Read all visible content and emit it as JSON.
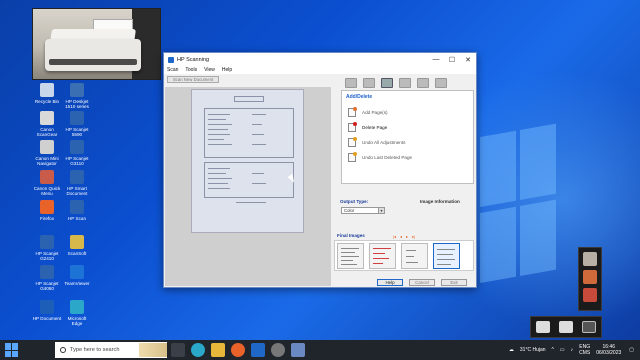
{
  "desktop": {
    "icons": [
      {
        "label": "Recycle Bin",
        "color": "#c9d7ea"
      },
      {
        "label": "HP Deskjet 1510 series",
        "color": "#3a6fb3"
      },
      {
        "label": "Canon ScanGear",
        "color": "#d9d9d9"
      },
      {
        "label": "HP Scanjet 5590",
        "color": "#2b63b0"
      },
      {
        "label": "Canon Mini Navigator",
        "color": "#d0d0d0"
      },
      {
        "label": "HP Scanjet G3110",
        "color": "#2b63b0"
      },
      {
        "label": "Canon Quick Menu",
        "color": "#c95b4a"
      },
      {
        "label": "HP Smart Document",
        "color": "#2b63b0"
      },
      {
        "label": "Firefox",
        "color": "#e8622a"
      },
      {
        "label": "HP Scan",
        "color": "#2b63b0"
      },
      {
        "label": "HP Scanjet G2410",
        "color": "#2b63b0"
      },
      {
        "label": "ScanSoft",
        "color": "#d7b84a"
      },
      {
        "label": "HP Scanjet G4050",
        "color": "#2b63b0"
      },
      {
        "label": "TeamViewer",
        "color": "#1e73d6"
      },
      {
        "label": "HP Document",
        "color": "#1d5fb8"
      },
      {
        "label": "Microsoft Edge",
        "color": "#2aa7c9"
      }
    ]
  },
  "window": {
    "title": "HP Scanning",
    "controls": {
      "minimize": "—",
      "maximize": "☐",
      "close": "✕"
    },
    "menu": [
      "Scan",
      "Tools",
      "View",
      "Help"
    ],
    "scan_new_document": "Scan New Document",
    "panel": {
      "heading": "Add/Delete",
      "items": [
        {
          "label": "Add Page(s)",
          "mark_color": "#e07030",
          "strong": false
        },
        {
          "label": "Delete Page",
          "mark_color": "#d02020",
          "strong": true
        },
        {
          "label": "Undo All Adjustments",
          "mark_color": "#e0a020",
          "strong": false
        },
        {
          "label": "Undo Last Deleted Page",
          "mark_color": "#e0a020",
          "strong": false
        }
      ]
    },
    "output_type_label": "Output Type:",
    "output_type_value": "Color",
    "image_information_label": "Image Information",
    "final_images_label": "Final Images",
    "nav_arrows": [
      "|◂",
      "◂",
      "▸",
      "▸|"
    ],
    "footer_buttons": {
      "help": "Help",
      "cancel": "Cancel",
      "exit": "Exit"
    }
  },
  "taskbar": {
    "search_placeholder": "Type here to search",
    "weather": "31°C  Hujan",
    "lang_top": "ENG",
    "lang_bottom": "CMS",
    "time": "16:46",
    "date": "06/03/2023"
  },
  "colors": {
    "accent": "#1f68c7",
    "taskbar": "#20242b"
  }
}
